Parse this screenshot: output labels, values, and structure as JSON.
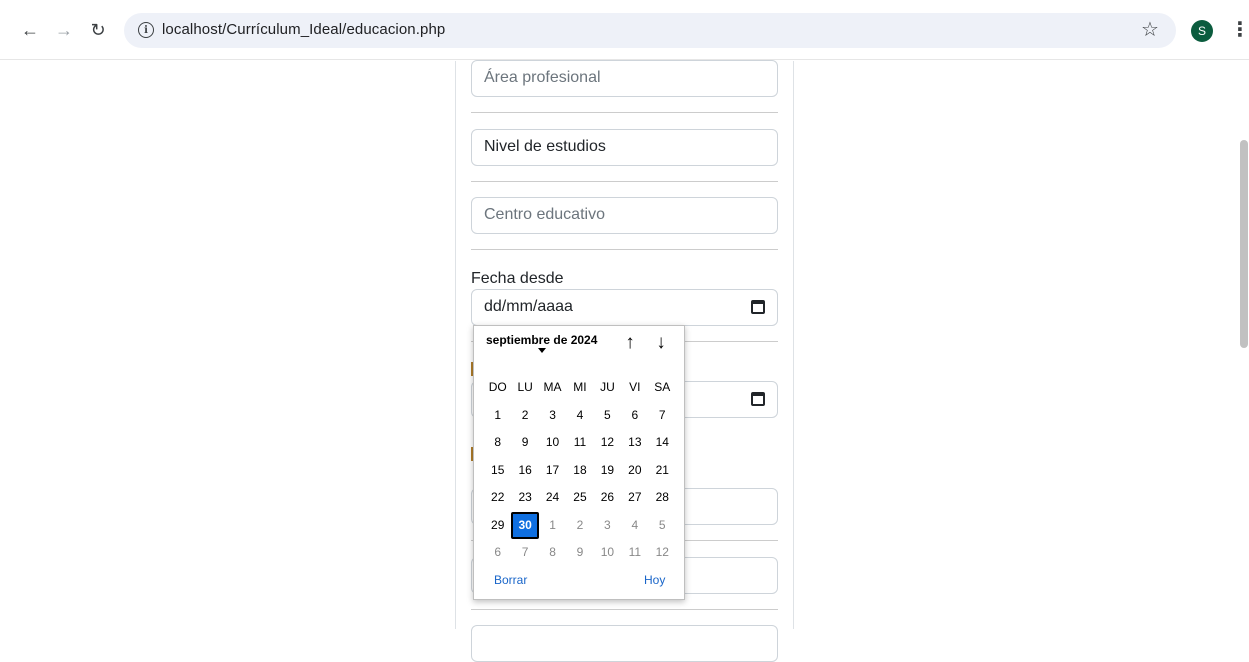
{
  "browser": {
    "url": "localhost/Currículum_Ideal/educacion.php",
    "avatar_letter": "S"
  },
  "form": {
    "area_placeholder": "Área profesional",
    "nivel_value": "Nivel de estudios",
    "centro_placeholder": "Centro educativo",
    "fecha_desde_label": "Fecha desde",
    "fecha_desde_value": "dd/mm/aaaa"
  },
  "datepicker": {
    "month_label": "septiembre de 2024",
    "weekdays": [
      "DO",
      "LU",
      "MA",
      "MI",
      "JU",
      "VI",
      "SA"
    ],
    "weeks": [
      [
        "1",
        "2",
        "3",
        "4",
        "5",
        "6",
        "7"
      ],
      [
        "8",
        "9",
        "10",
        "11",
        "12",
        "13",
        "14"
      ],
      [
        "15",
        "16",
        "17",
        "18",
        "19",
        "20",
        "21"
      ],
      [
        "22",
        "23",
        "24",
        "25",
        "26",
        "27",
        "28"
      ],
      [
        "29",
        "30",
        "1",
        "2",
        "3",
        "4",
        "5"
      ],
      [
        "6",
        "7",
        "8",
        "9",
        "10",
        "11",
        "12"
      ]
    ],
    "selected": "30",
    "clear_label": "Borrar",
    "today_label": "Hoy"
  },
  "colors": {
    "selected_day": "#0f6fe0",
    "link": "#1a66c9",
    "avatar": "#0b5c3e"
  }
}
